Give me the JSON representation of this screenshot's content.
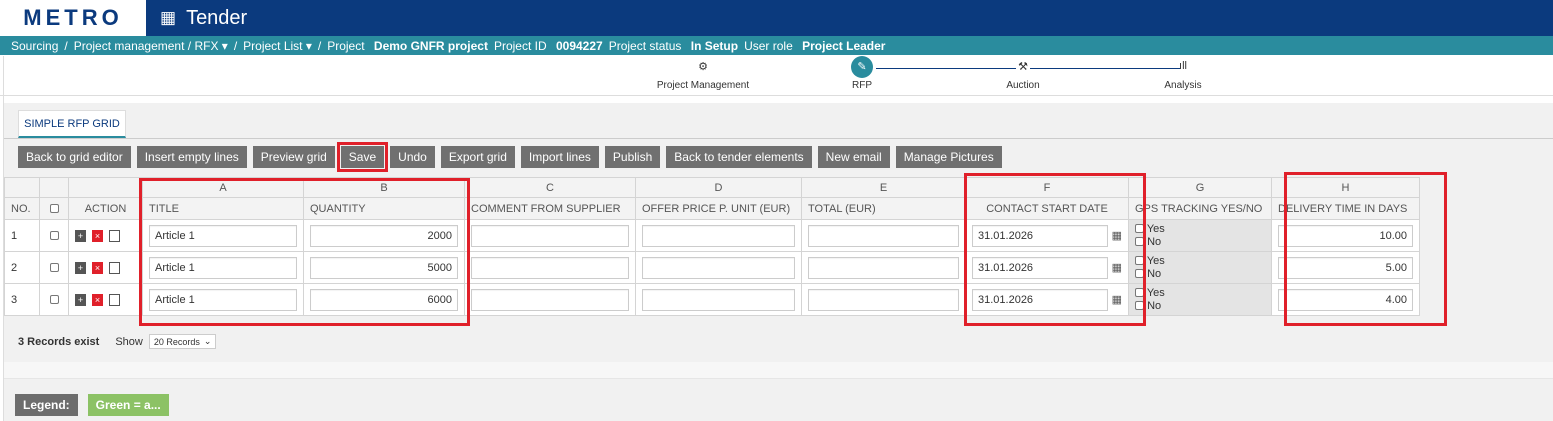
{
  "header": {
    "logo": "METRO",
    "title": "Tender",
    "title_icon": "grid-icon"
  },
  "breadcrumb": {
    "sourcing": "Sourcing",
    "sep1": "/",
    "project_mgmt": "Project management / RFX ▾",
    "sep2": "/",
    "project_list": "Project List ▾",
    "sep3": "/",
    "project_label": "Project",
    "project_name": "Demo GNFR project",
    "project_id_label": "Project ID",
    "project_id": "0094227",
    "status_label": "Project status",
    "status": "In Setup",
    "role_label": "User role",
    "role": "Project Leader"
  },
  "steps": [
    {
      "label": "Project Management",
      "icon": "⚙"
    },
    {
      "label": "RFP",
      "icon": "✎"
    },
    {
      "label": "Auction",
      "icon": "⚒"
    },
    {
      "label": "Analysis",
      "icon": "ıll"
    }
  ],
  "tab": {
    "label": "SIMPLE RFP GRID"
  },
  "toolbar": {
    "back_grid_editor": "Back to grid editor",
    "insert_empty": "Insert empty lines",
    "preview": "Preview grid",
    "save": "Save",
    "undo": "Undo",
    "export": "Export grid",
    "import": "Import lines",
    "publish": "Publish",
    "back_tender": "Back to tender elements",
    "new_email": "New email",
    "manage_pictures": "Manage Pictures"
  },
  "grid": {
    "letters": [
      "A",
      "B",
      "C",
      "D",
      "E",
      "F",
      "G",
      "H"
    ],
    "headers": {
      "no": "NO.",
      "action": "ACTION",
      "title": "TITLE",
      "quantity": "QUANTITY",
      "comment": "COMMENT FROM SUPPLIER",
      "offer": "OFFER PRICE P. UNIT (EUR)",
      "total": "TOTAL (EUR)",
      "contact": "CONTACT START DATE",
      "gps": "GPS TRACKING YES/NO",
      "delivery": "DELIVERY TIME IN DAYS"
    },
    "gps_yes": "Yes",
    "gps_no": "No",
    "rows": [
      {
        "no": "1",
        "title": "Article 1",
        "quantity": "2000",
        "date": "31.01.2026",
        "delivery": "10.00"
      },
      {
        "no": "2",
        "title": "Article 1",
        "quantity": "5000",
        "date": "31.01.2026",
        "delivery": "5.00"
      },
      {
        "no": "3",
        "title": "Article 1",
        "quantity": "6000",
        "date": "31.01.2026",
        "delivery": "4.00"
      }
    ]
  },
  "footer": {
    "records": "3 Records exist",
    "show_label": "Show",
    "show_value": "20 Records"
  },
  "legend": {
    "label": "Legend:",
    "green": "Green = a..."
  }
}
